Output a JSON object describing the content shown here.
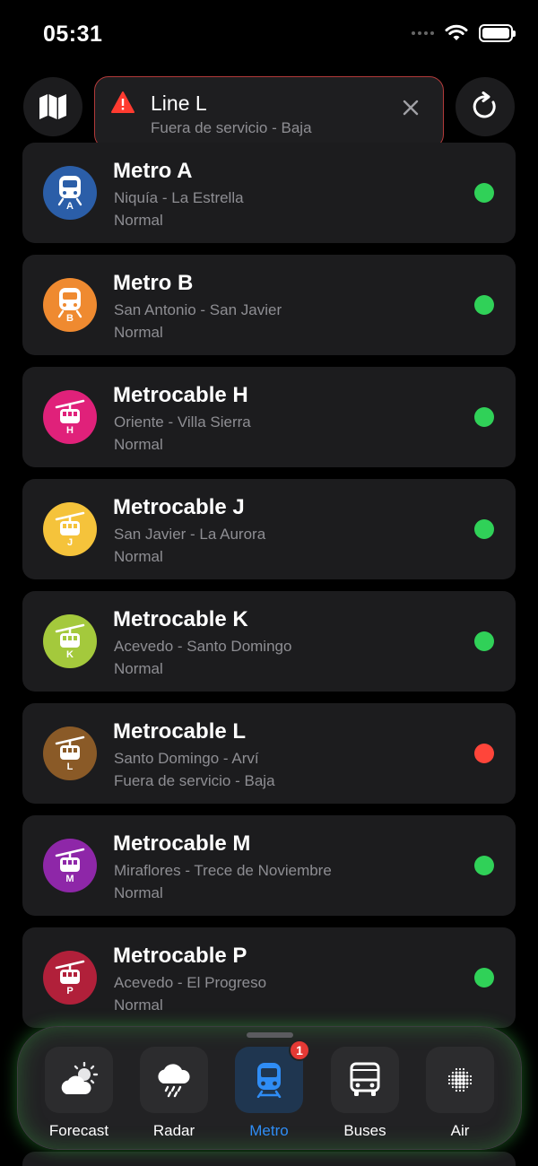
{
  "status_bar": {
    "time": "05:31"
  },
  "alert": {
    "title": "Line L",
    "subtitle": "Fuera de servicio - Baja",
    "icon": "warning-icon"
  },
  "colors": {
    "ok": "#30d158",
    "down": "#ff453a",
    "accent": "#2f8df5"
  },
  "lines": [
    {
      "name": "Metro A",
      "route": "Niquía - La Estrella",
      "state": "Normal",
      "letter": "A",
      "kind": "metro",
      "color": "#2b5ea8",
      "status": "ok"
    },
    {
      "name": "Metro B",
      "route": "San Antonio - San Javier",
      "state": "Normal",
      "letter": "B",
      "kind": "metro",
      "color": "#ef8a30",
      "status": "ok"
    },
    {
      "name": "Metrocable H",
      "route": "Oriente - Villa Sierra",
      "state": "Normal",
      "letter": "H",
      "kind": "cable",
      "color": "#e0217a",
      "status": "ok"
    },
    {
      "name": "Metrocable J",
      "route": "San Javier - La Aurora",
      "state": "Normal",
      "letter": "J",
      "kind": "cable",
      "color": "#f5c33b",
      "status": "ok"
    },
    {
      "name": "Metrocable K",
      "route": "Acevedo - Santo Domingo",
      "state": "Normal",
      "letter": "K",
      "kind": "cable",
      "color": "#a4c93c",
      "status": "ok"
    },
    {
      "name": "Metrocable L",
      "route": "Santo Domingo - Arví",
      "state": "Fuera de servicio - Baja",
      "letter": "L",
      "kind": "cable",
      "color": "#8a5a27",
      "status": "down"
    },
    {
      "name": "Metrocable M",
      "route": "Miraflores - Trece de Noviembre",
      "state": "Normal",
      "letter": "M",
      "kind": "cable",
      "color": "#8e27a8",
      "status": "ok"
    },
    {
      "name": "Metrocable P",
      "route": "Acevedo - El Progreso",
      "state": "Normal",
      "letter": "P",
      "kind": "cable",
      "color": "#b1203a",
      "status": "ok"
    }
  ],
  "tabs": [
    {
      "label": "Forecast",
      "icon": "partly-cloudy-icon",
      "active": false
    },
    {
      "label": "Radar",
      "icon": "rain-cloud-icon",
      "active": false
    },
    {
      "label": "Metro",
      "icon": "train-icon",
      "active": true,
      "badge": "1"
    },
    {
      "label": "Buses",
      "icon": "bus-icon",
      "active": false
    },
    {
      "label": "Air",
      "icon": "air-quality-icon",
      "active": false
    }
  ]
}
